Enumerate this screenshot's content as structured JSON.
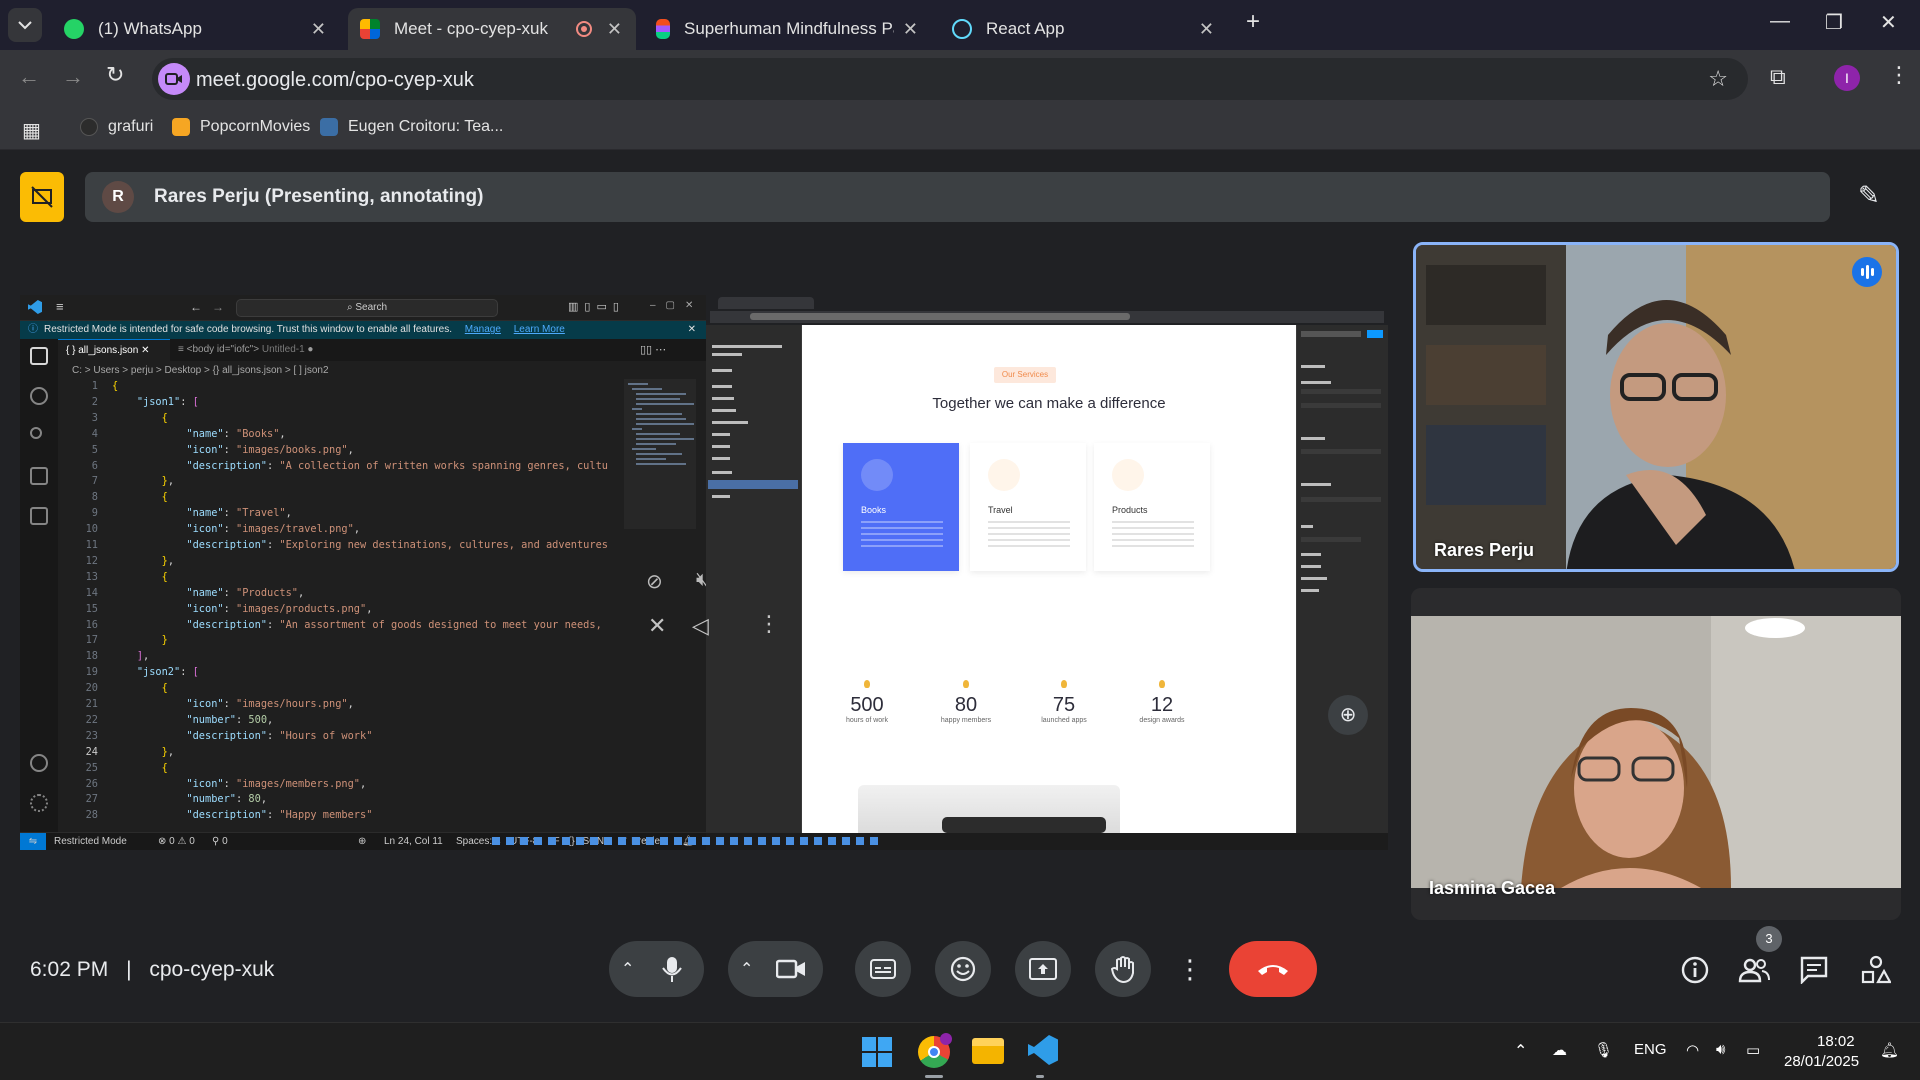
{
  "browser": {
    "tabs": [
      {
        "label": "(1) WhatsApp",
        "color": "#25d366"
      },
      {
        "label": "Meet - cpo-cyep-xuk",
        "color": "#00897b"
      },
      {
        "label": "Superhuman Mindfulness Pack",
        "color": "#f24e1e"
      },
      {
        "label": "React App",
        "color": "#61dafb"
      }
    ],
    "url": "meet.google.com/cpo-cyep-xuk",
    "profile_initial": "I",
    "bookmarks": [
      "grafuri",
      "PopcornMovies",
      "Eugen Croitoru: Tea..."
    ]
  },
  "meet": {
    "banner_avatar": "R",
    "banner_text": "Rares Perju (Presenting, annotating)",
    "time": "6:02 PM",
    "separator": "|",
    "code": "cpo-cyep-xuk",
    "participants": [
      {
        "name": "Rares Perju"
      },
      {
        "name": "Iasmina Gacea"
      }
    ],
    "people_count": "3",
    "accent": "#1a73e8",
    "hangup_color": "#ea4335"
  },
  "vscode": {
    "search": "Search",
    "warning": "Restricted Mode is intended for safe code browsing. Trust this window to enable all features.",
    "manage": "Manage",
    "learn_more": "Learn More",
    "tab1": "all_jsons.json",
    "tab2": "<body id=\"iofc\">",
    "tab2_sub": "Untitled-1",
    "breadcrumb": "C: > Users > perju > Desktop > {} all_jsons.json > [ ] json2",
    "status": {
      "mode": "Restricted Mode",
      "problems": "⊗ 0 ⚠ 0",
      "ports": "⚲ 0",
      "cursor": "Ln 24, Col 11",
      "spaces": "Spaces: 4",
      "encoding": "UTF-8",
      "eol": "LF",
      "language": "{} JSON",
      "formatter": "✓ Prettier"
    },
    "lines": [
      {
        "n": "1",
        "html": "<span class='b'>{</span>"
      },
      {
        "n": "2",
        "html": "    <span class='k'>\"json1\"</span>: <span class='p'>[</span>"
      },
      {
        "n": "3",
        "html": "        <span class='b'>{</span>"
      },
      {
        "n": "4",
        "html": "            <span class='k'>\"name\"</span>: <span class='s'>\"Books\"</span>,"
      },
      {
        "n": "5",
        "html": "            <span class='k'>\"icon\"</span>: <span class='s'>\"images/books.png\"</span>,"
      },
      {
        "n": "6",
        "html": "            <span class='k'>\"description\"</span>: <span class='s'>\"A collection of written works spanning genres, cultu</span>"
      },
      {
        "n": "7",
        "html": "        <span class='b'>}</span>,"
      },
      {
        "n": "8",
        "html": "        <span class='b'>{</span>"
      },
      {
        "n": "9",
        "html": "            <span class='k'>\"name\"</span>: <span class='s'>\"Travel\"</span>,"
      },
      {
        "n": "10",
        "html": "            <span class='k'>\"icon\"</span>: <span class='s'>\"images/travel.png\"</span>,"
      },
      {
        "n": "11",
        "html": "            <span class='k'>\"description\"</span>: <span class='s'>\"Exploring new destinations, cultures, and adventures</span>"
      },
      {
        "n": "12",
        "html": "        <span class='b'>}</span>,"
      },
      {
        "n": "13",
        "html": "        <span class='b'>{</span>"
      },
      {
        "n": "14",
        "html": "            <span class='k'>\"name\"</span>: <span class='s'>\"Products\"</span>,"
      },
      {
        "n": "15",
        "html": "            <span class='k'>\"icon\"</span>: <span class='s'>\"images/products.png\"</span>,"
      },
      {
        "n": "16",
        "html": "            <span class='k'>\"description\"</span>: <span class='s'>\"An assortment of goods designed to meet your needs,</span>"
      },
      {
        "n": "17",
        "html": "        <span class='b'>}</span>"
      },
      {
        "n": "18",
        "html": "    <span class='p'>]</span>,"
      },
      {
        "n": "19",
        "html": "    <span class='k'>\"json2\"</span>: <span class='p'>[</span>"
      },
      {
        "n": "20",
        "html": "        <span class='b'>{</span>"
      },
      {
        "n": "21",
        "html": "            <span class='k'>\"icon\"</span>: <span class='s'>\"images/hours.png\"</span>,"
      },
      {
        "n": "22",
        "html": "            <span class='k'>\"number\"</span>: <span class='n'>500</span>,"
      },
      {
        "n": "23",
        "html": "            <span class='k'>\"description\"</span>: <span class='s'>\"Hours of work\"</span>"
      },
      {
        "n": "24",
        "html": "        <span class='b'>}</span>,"
      },
      {
        "n": "25",
        "html": "        <span class='b'>{</span>"
      },
      {
        "n": "26",
        "html": "            <span class='k'>\"icon\"</span>: <span class='s'>\"images/members.png\"</span>,"
      },
      {
        "n": "27",
        "html": "            <span class='k'>\"number\"</span>: <span class='n'>80</span>,"
      },
      {
        "n": "28",
        "html": "            <span class='k'>\"description\"</span>: <span class='s'>\"Happy members\"</span>"
      }
    ]
  },
  "figma": {
    "tag": "Our Services",
    "title": "Together we can make a difference",
    "cards": [
      {
        "title": "Books",
        "color": "#4f6ef7"
      },
      {
        "title": "Travel",
        "color": "#ffffff"
      },
      {
        "title": "Products",
        "color": "#ffffff"
      }
    ],
    "stats": [
      {
        "value": "500",
        "label": "hours of work"
      },
      {
        "value": "80",
        "label": "happy members"
      },
      {
        "value": "75",
        "label": "launched apps"
      },
      {
        "value": "12",
        "label": "design awards"
      }
    ]
  },
  "taskbar": {
    "lang": "ENG",
    "time": "18:02",
    "date": "28/01/2025"
  }
}
